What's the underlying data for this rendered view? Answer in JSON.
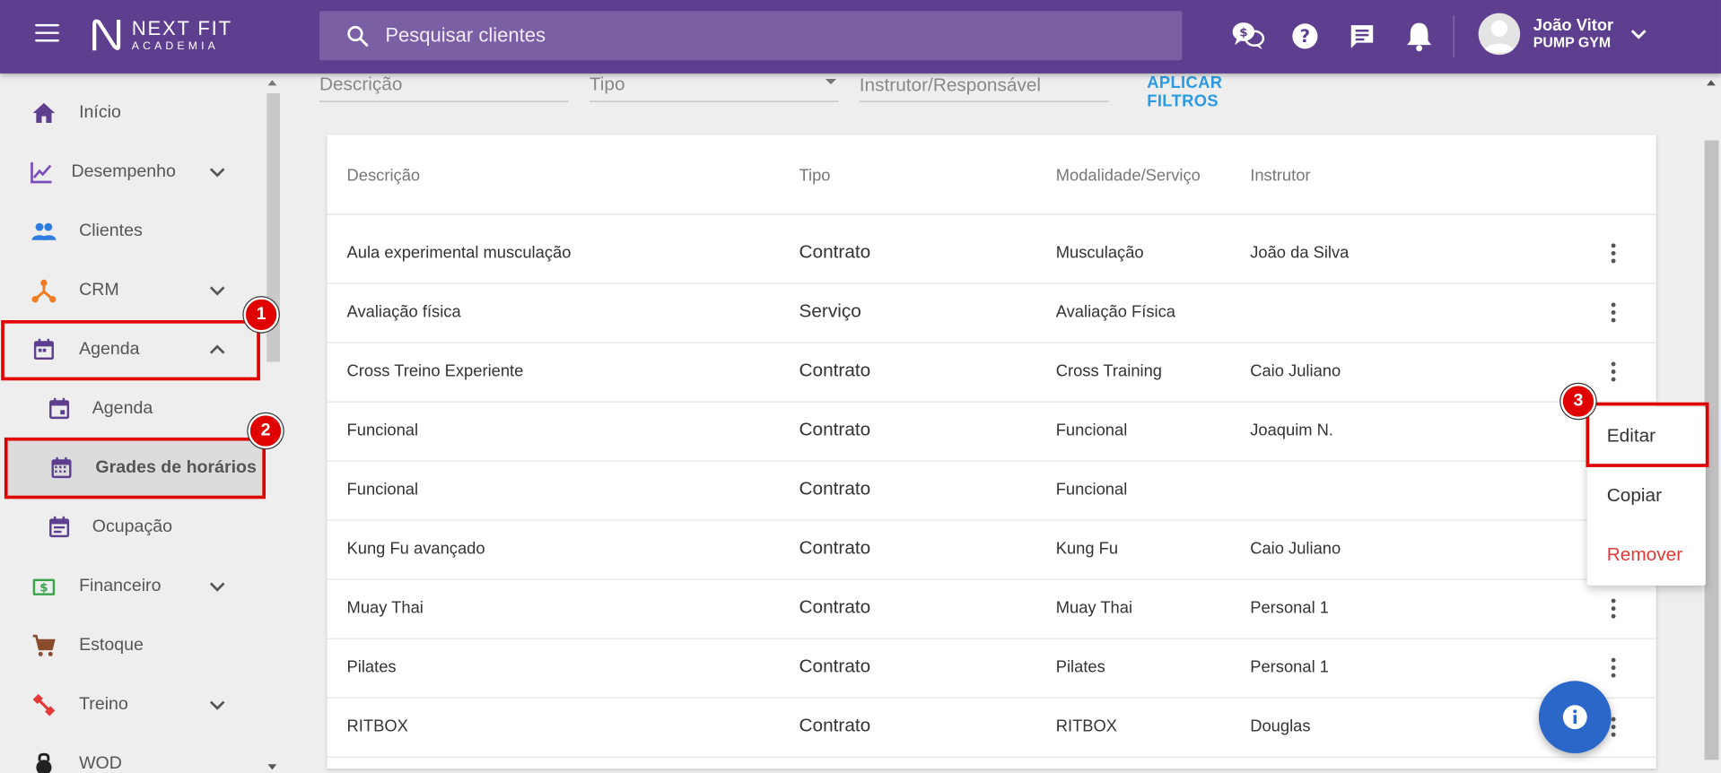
{
  "header": {
    "logo_line1": "NEXT FIT",
    "logo_line2": "ACADEMIA",
    "search_placeholder": "Pesquisar clientes",
    "user_name": "João Vitor",
    "user_gym": "PUMP GYM",
    "icons": [
      "chat-money-icon",
      "help-icon",
      "message-icon",
      "bell-icon"
    ],
    "background": "#5e3f8f"
  },
  "sidebar": {
    "items": [
      {
        "label": "Início",
        "icon": "home-icon"
      },
      {
        "label": "Desempenho",
        "icon": "chart-line-icon"
      },
      {
        "label": "Clientes",
        "icon": "people-icon"
      },
      {
        "label": "CRM",
        "icon": "crm-icon"
      },
      {
        "label": "Agenda",
        "icon": "calendar-icon"
      },
      {
        "label": "Agenda",
        "icon": "calendar-icon"
      },
      {
        "label": "Grades de horários",
        "icon": "calendar-grid-icon"
      },
      {
        "label": "Ocupação",
        "icon": "calendar-list-icon"
      },
      {
        "label": "Financeiro",
        "icon": "money-icon"
      },
      {
        "label": "Estoque",
        "icon": "cart-icon"
      },
      {
        "label": "Treino",
        "icon": "dumbbell-icon"
      },
      {
        "label": "WOD",
        "icon": "kettlebell-icon"
      }
    ]
  },
  "filters": {
    "descricao": "Descrição",
    "tipo": "Tipo",
    "instrutor": "Instrutor/Responsável",
    "apply": "APLICAR FILTROS"
  },
  "table": {
    "headers": [
      "Descrição",
      "Tipo",
      "Modalidade/Serviço",
      "Instrutor"
    ],
    "rows": [
      [
        "Aula experimental musculação",
        "Contrato",
        "Musculação",
        "João da Silva"
      ],
      [
        "Avaliação física",
        "Serviço",
        "Avaliação Física",
        ""
      ],
      [
        "Cross Treino Experiente",
        "Contrato",
        "Cross Training",
        "Caio Juliano"
      ],
      [
        "Funcional",
        "Contrato",
        "Funcional",
        "Joaquim N."
      ],
      [
        "Funcional",
        "Contrato",
        "Funcional",
        ""
      ],
      [
        "Kung Fu avançado",
        "Contrato",
        "Kung Fu",
        "Caio Juliano"
      ],
      [
        "Muay Thai",
        "Contrato",
        "Muay Thai",
        "Personal 1"
      ],
      [
        "Pilates",
        "Contrato",
        "Pilates",
        "Personal 1"
      ],
      [
        "RITBOX",
        "Contrato",
        "RITBOX",
        "Douglas"
      ]
    ]
  },
  "menu": {
    "items": [
      "Editar",
      "Copiar",
      "Remover"
    ]
  },
  "annotations": {
    "steps": [
      "1",
      "2",
      "3"
    ],
    "color": "#e00000"
  },
  "colors": {
    "accent_link": "#2b9ae3",
    "fab": "#2a67c8",
    "danger": "#e53935"
  }
}
